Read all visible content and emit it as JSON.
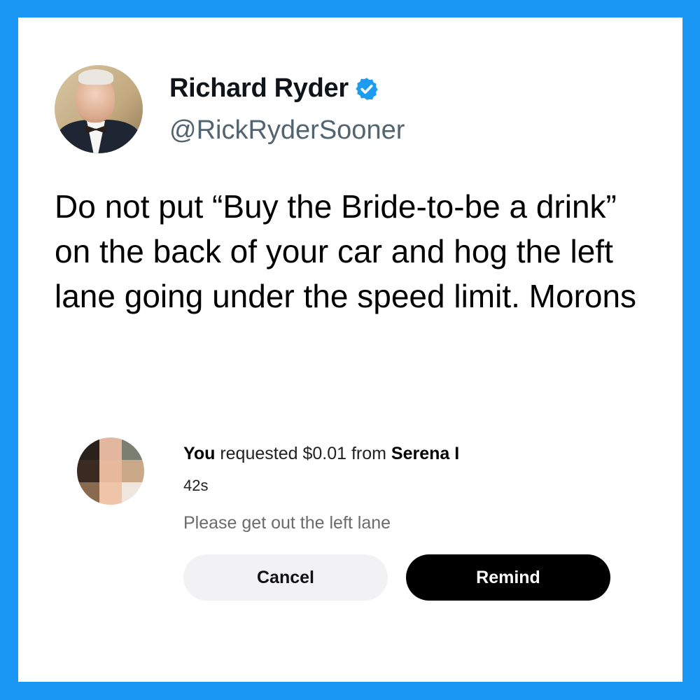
{
  "tweet": {
    "author_name": "Richard Ryder",
    "handle": "@RickRyderSooner",
    "verified_icon": "verified-badge-icon",
    "text": "Do not put “Buy the Bride-to-be a drink” on the back of your car and hog the left lane going under the speed limit. Morons"
  },
  "payment": {
    "actor": "You",
    "action": " requested $0.01 from ",
    "recipient": "Serena I",
    "time": "42s",
    "note": "Please get out the left lane",
    "cancel_label": "Cancel",
    "remind_label": "Remind"
  },
  "colors": {
    "frame": "#1a96f4",
    "verified": "#1d9bf0",
    "handle": "#536471",
    "remind_button": "#000000",
    "cancel_button": "#f2f2f4"
  }
}
